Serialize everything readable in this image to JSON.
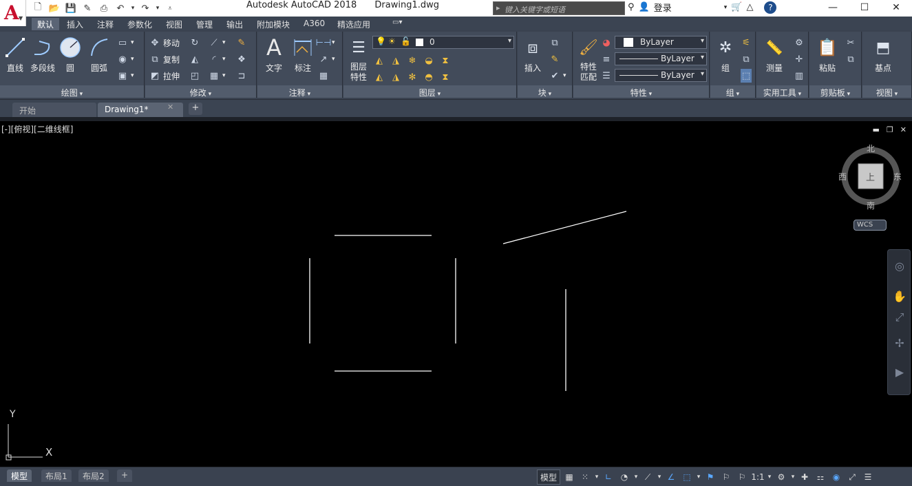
{
  "app": {
    "title": "Autodesk AutoCAD 2018",
    "document": "Drawing1.dwg",
    "search_placeholder": "键入关键字或短语",
    "login_label": "登录"
  },
  "ribbon_tabs": [
    "默认",
    "插入",
    "注释",
    "参数化",
    "视图",
    "管理",
    "输出",
    "附加模块",
    "A360",
    "精选应用"
  ],
  "draw_panel": {
    "title": "绘图",
    "line": "直线",
    "polyline": "多段线",
    "circle": "圆",
    "arc": "圆弧"
  },
  "modify_panel": {
    "title": "修改",
    "move": "移动",
    "copy": "复制",
    "stretch": "拉伸"
  },
  "annotation_panel": {
    "title": "注释",
    "text": "文字",
    "dimension": "标注"
  },
  "layers_panel": {
    "title": "图层",
    "layer_properties": "图层特性",
    "current_layer": "0"
  },
  "block_panel": {
    "title": "块",
    "insert": "插入"
  },
  "properties_panel": {
    "title": "特性",
    "match_properties": "特性匹配",
    "color": "ByLayer",
    "linetype": "ByLayer",
    "lineweight": "ByLayer"
  },
  "groups_panel": {
    "title": "组",
    "group": "组"
  },
  "utilities_panel": {
    "title": "实用工具",
    "measure": "测量"
  },
  "clipboard_panel": {
    "title": "剪贴板",
    "paste": "粘贴"
  },
  "view_panel": {
    "title": "视图",
    "base": "基点"
  },
  "doc_tabs": {
    "start": "开始",
    "drawing": "Drawing1*"
  },
  "viewport": {
    "label": "[-][俯视][二维线框]"
  },
  "viewcube": {
    "north": "北",
    "south": "南",
    "east": "东",
    "west": "西",
    "top": "上",
    "wcs": "WCS"
  },
  "ucs": {
    "x": "X",
    "y": "Y"
  },
  "layout_tabs": [
    "模型",
    "布局1",
    "布局2"
  ],
  "status": {
    "model": "模型",
    "scale": "1:1"
  },
  "colors": {
    "ribbon_bg": "#424b5a",
    "canvas_bg": "#000000",
    "accent_red": "#c8102e",
    "status_blue": "#5aa8ff"
  }
}
